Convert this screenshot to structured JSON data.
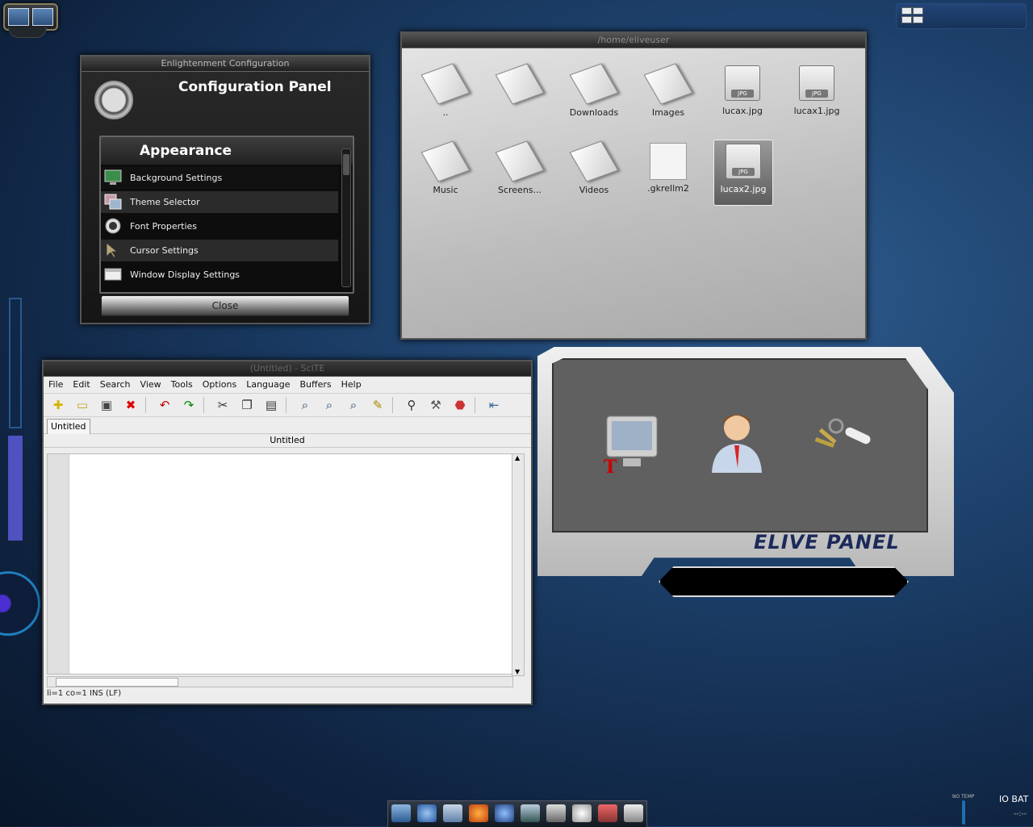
{
  "config": {
    "window_title": "Enlightenment Configuration",
    "heading": "Configuration Panel",
    "category": "Appearance",
    "items": [
      {
        "label": "Background Settings",
        "icon": "monitor-icon"
      },
      {
        "label": "Theme Selector",
        "icon": "theme-icon"
      },
      {
        "label": "Font Properties",
        "icon": "font-icon"
      },
      {
        "label": "Cursor Settings",
        "icon": "cursor-icon"
      },
      {
        "label": "Window Display Settings",
        "icon": "window-icon"
      }
    ],
    "close_label": "Close"
  },
  "filemanager": {
    "title": "/home/eliveuser",
    "items": [
      {
        "label": "..",
        "type": "folder"
      },
      {
        "label": "",
        "type": "folder"
      },
      {
        "label": "Downloads",
        "type": "folder"
      },
      {
        "label": "Images",
        "type": "folder"
      },
      {
        "label": "lucax.jpg",
        "type": "jpg"
      },
      {
        "label": "lucax1.jpg",
        "type": "jpg"
      },
      {
        "label": "Music",
        "type": "folder"
      },
      {
        "label": "Screens...",
        "type": "folder"
      },
      {
        "label": "Videos",
        "type": "folder"
      },
      {
        "label": ".gkrellm2",
        "type": "file"
      },
      {
        "label": "lucax2.jpg",
        "type": "jpg",
        "selected": true
      }
    ]
  },
  "editor": {
    "title": "(Untitled) - SciTE",
    "menu": [
      "File",
      "Edit",
      "Search",
      "View",
      "Tools",
      "Options",
      "Language",
      "Buffers",
      "Help"
    ],
    "toolbar_icons": [
      "new-file-icon",
      "open-folder-icon",
      "save-icon",
      "close-icon",
      "undo-icon",
      "redo-icon",
      "cut-icon",
      "copy-icon",
      "paste-icon",
      "find-icon",
      "find-next-icon",
      "zoom-icon",
      "replace-icon",
      "binoculars-icon",
      "build-icon",
      "stop-icon",
      "jump-icon"
    ],
    "tab_label": "Untitled",
    "document_name": "Untitled",
    "status": "li=1 co=1 INS (LF)"
  },
  "elive_panel": {
    "title": "ELIVE PANEL",
    "icons": [
      "system-settings-icon",
      "user-icon",
      "keys-icon"
    ]
  },
  "taskbar": {
    "icons": [
      "desktop-icon",
      "network-icon",
      "files-icon",
      "firefox-icon",
      "messenger-icon",
      "terminal-icon",
      "devices-icon",
      "cd-icon",
      "tools-icon",
      "trash-icon"
    ]
  },
  "systray": {
    "temp_label": "NO TEMP",
    "bat_label": "IO BAT",
    "bat_value": "--:--"
  },
  "colors": {
    "desktop_bg": "#1b3d66",
    "accent_brand": "#5a5bd6"
  }
}
